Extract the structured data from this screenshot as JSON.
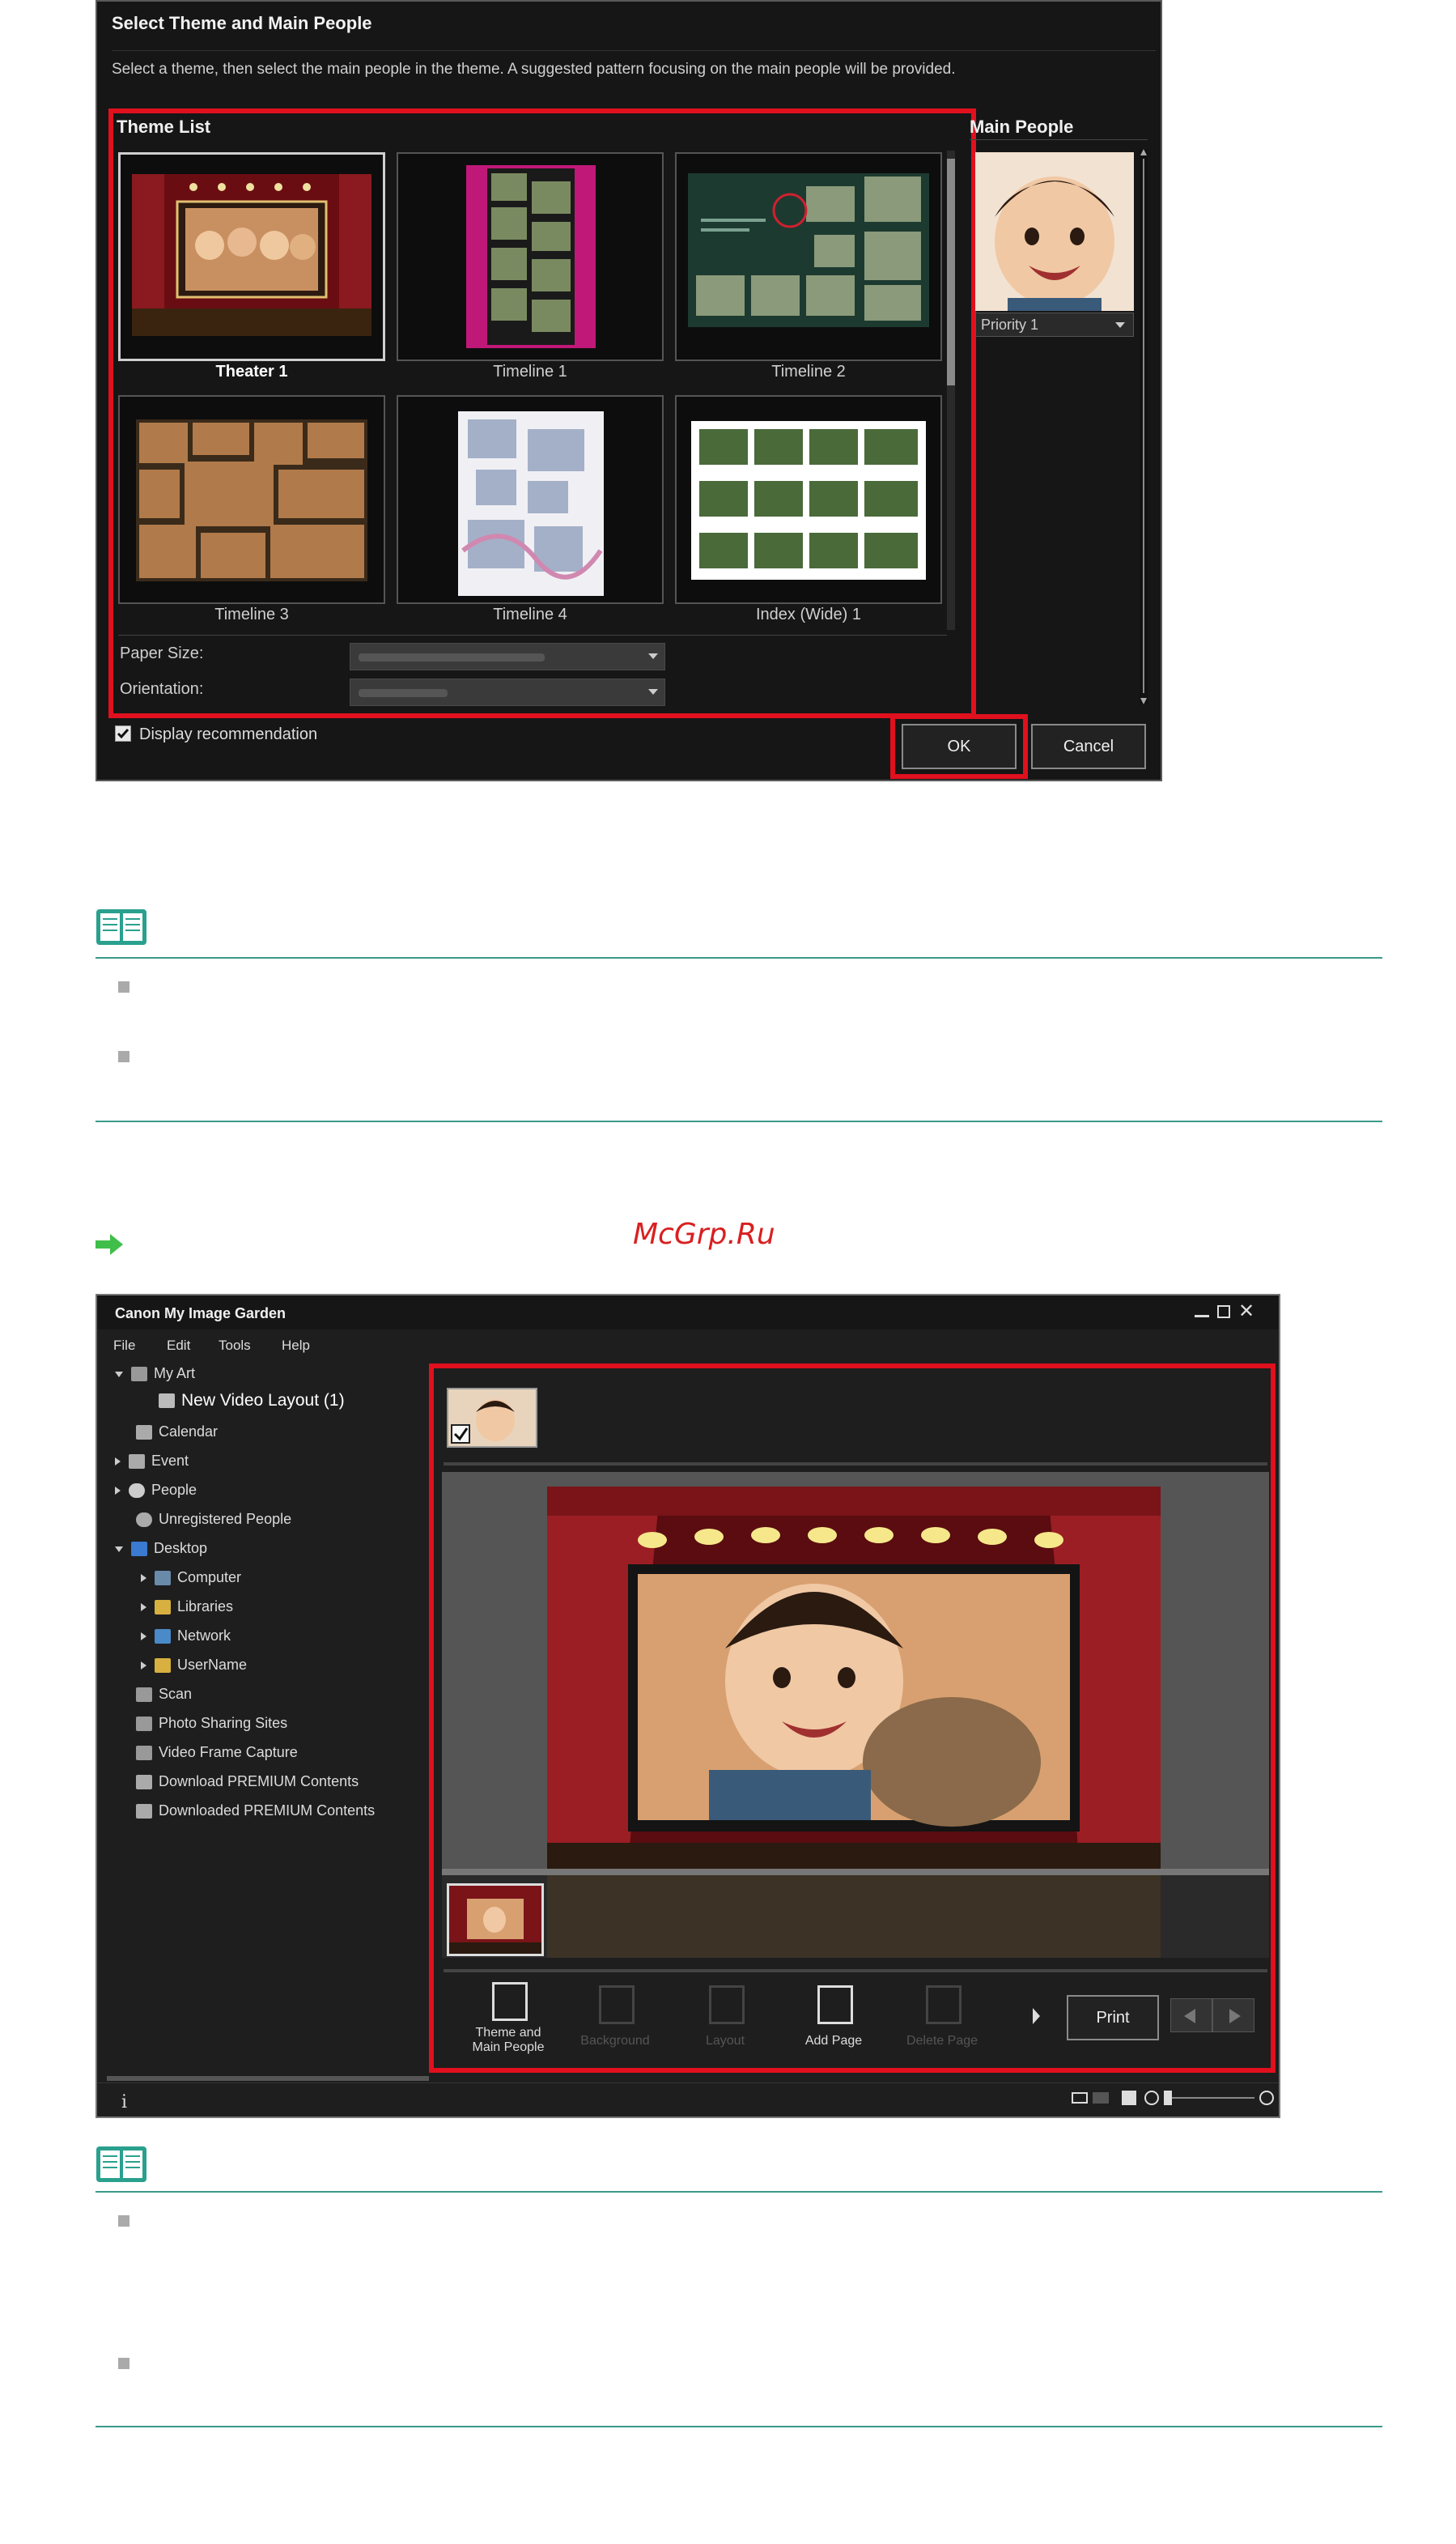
{
  "dialog": {
    "title": "Select Theme and Main People",
    "description": "Select a theme, then select the main people in the theme. A suggested pattern focusing on the main people will be provided.",
    "theme_list_title": "Theme List",
    "themes": [
      {
        "label": "Theater 1"
      },
      {
        "label": "Timeline 1"
      },
      {
        "label": "Timeline 2"
      },
      {
        "label": "Timeline 3"
      },
      {
        "label": "Timeline 4"
      },
      {
        "label": "Index (Wide) 1"
      }
    ],
    "paper_size_label": "Paper Size:",
    "orientation_label": "Orientation:",
    "main_people_title": "Main People",
    "priority_value": "Priority 1",
    "display_recommendation": "Display recommendation",
    "ok": "OK",
    "cancel": "Cancel"
  },
  "watermark": "McGrp.Ru",
  "app": {
    "title": "Canon My Image Garden",
    "menu": [
      "File",
      "Edit",
      "Tools",
      "Help"
    ],
    "tree": [
      {
        "label": "My Art"
      },
      {
        "label": "New Video Layout (1)"
      },
      {
        "label": "Calendar"
      },
      {
        "label": "Event"
      },
      {
        "label": "People"
      },
      {
        "label": "Unregistered People"
      },
      {
        "label": "Desktop"
      },
      {
        "label": "Computer"
      },
      {
        "label": "Libraries"
      },
      {
        "label": "Network"
      },
      {
        "label": "UserName"
      },
      {
        "label": "Scan"
      },
      {
        "label": "Photo Sharing Sites"
      },
      {
        "label": "Video Frame Capture"
      },
      {
        "label": "Download PREMIUM Contents"
      },
      {
        "label": "Downloaded PREMIUM Contents"
      }
    ],
    "toolbar": {
      "theme_line1": "Theme and",
      "theme_line2": "Main People",
      "background": "Background",
      "layout": "Layout",
      "add_page": "Add Page",
      "delete_page": "Delete Page",
      "print": "Print"
    },
    "info_icon": "i"
  },
  "colors": {
    "highlight": "#e0101e",
    "note_line": "#3a9a8a",
    "note_icon": "#2aa08e",
    "arrow": "#3fbf4a"
  }
}
